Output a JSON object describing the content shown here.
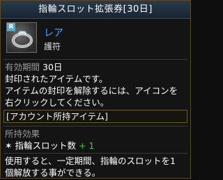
{
  "title": "指輪スロット拡張券[30日]",
  "item": {
    "rarity_badge": "R",
    "rarity": "レア",
    "category": "護符",
    "icon": "ring-icon"
  },
  "validity": {
    "label": "有効期間",
    "value": "30日"
  },
  "description_lines": [
    "封印されたアイテムです。",
    "アイテムの封印を解除するには、アイコンを",
    "右クリックしてください。"
  ],
  "account_item": "[アカウント所持アイテム]",
  "effect": {
    "header": "所持効果",
    "bullet": "✶",
    "name": "指輪スロット数",
    "value": "+ 1"
  },
  "usage_lines": [
    "使用すると、一定期間、指輪のスロットを1",
    "個解放する事ができる。"
  ],
  "colors": {
    "rarity": "#4fa3ff",
    "effect_value": "#39d14a",
    "title_bar": "#2a3a4d"
  }
}
